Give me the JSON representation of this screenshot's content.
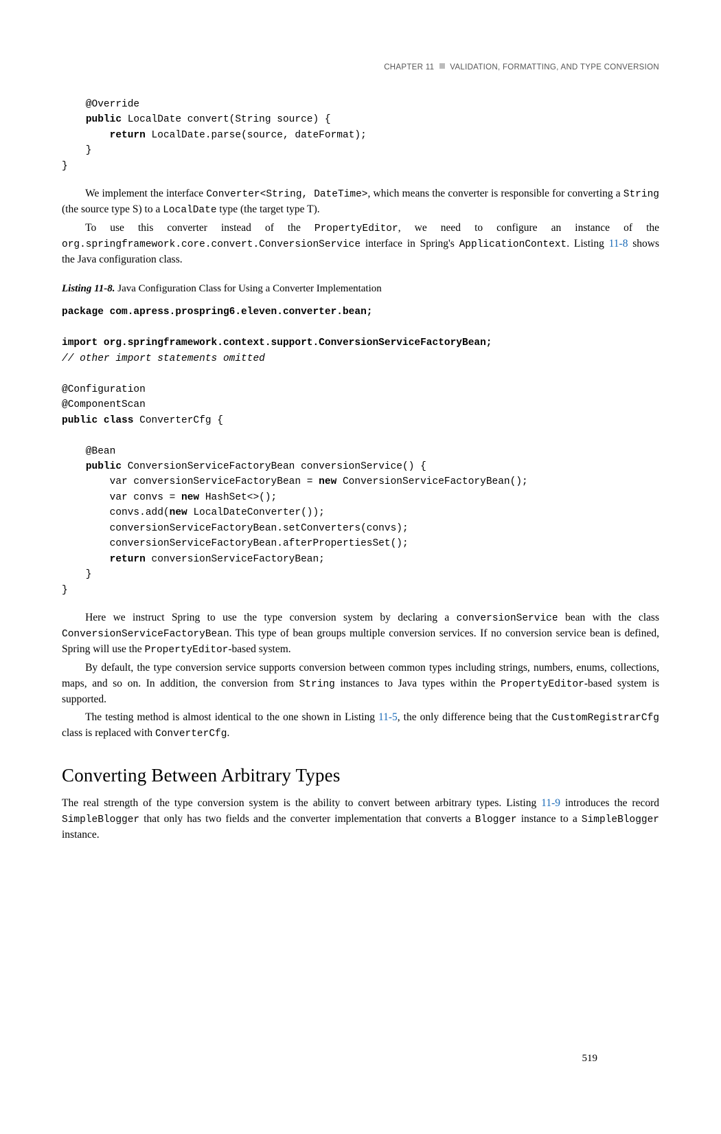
{
  "header": {
    "chapter": "CHAPTER 11",
    "title": "VALIDATION, FORMATTING, AND TYPE CONVERSION"
  },
  "code1": {
    "l1": "    @Override",
    "l2a": "    ",
    "l2_kw1": "public",
    "l2b": " LocalDate convert(String source) {",
    "l3a": "        ",
    "l3_kw1": "return",
    "l3b": " LocalDate.parse(source, dateFormat);",
    "l4": "    }",
    "l5": "}"
  },
  "para1": {
    "t1": "We implement the interface ",
    "m1": "Converter<String, DateTime>",
    "t2": ", which means the converter is responsible for converting a ",
    "m2": "String",
    "t3": " (the source type S) to a ",
    "m3": "LocalDate",
    "t4": " type (the target type T)."
  },
  "para2": {
    "t1": "To use this converter instead of the ",
    "m1": "PropertyEditor",
    "t2": ", we need to configure an instance of the ",
    "m2": "org.springframework.core.convert.ConversionService",
    "t3": " interface in Spring's ",
    "m3": "ApplicationContext",
    "t4": ". Listing ",
    "x1": "11-8",
    "t5": " shows the Java configuration class."
  },
  "listing8": {
    "label": "Listing 11-8.",
    "caption": "  Java Configuration Class for Using a Converter Implementation"
  },
  "code2": {
    "l1_kw": "package",
    "l1": " com.apress.prospring6.eleven.converter.bean;",
    "l3_kw": "import",
    "l3": " org.springframework.context.support.ConversionServiceFactoryBean;",
    "l4": "// other import statements omitted",
    "l6": "@Configuration",
    "l7": "@ComponentScan",
    "l8_kw": "public class",
    "l8": " ConverterCfg {",
    "l10": "    @Bean",
    "l11a": "    ",
    "l11_kw": "public",
    "l11b": " ConversionServiceFactoryBean conversionService() {",
    "l12a": "        var conversionServiceFactoryBean = ",
    "l12_kw": "new",
    "l12b": " ConversionServiceFactoryBean();",
    "l13a": "        var convs = ",
    "l13_kw": "new",
    "l13b": " HashSet<>();",
    "l14a": "        convs.add(",
    "l14_kw": "new",
    "l14b": " LocalDateConverter());",
    "l15": "        conversionServiceFactoryBean.setConverters(convs);",
    "l16": "        conversionServiceFactoryBean.afterPropertiesSet();",
    "l17a": "        ",
    "l17_kw": "return",
    "l17b": " conversionServiceFactoryBean;",
    "l18": "    }",
    "l19": "}"
  },
  "para3": {
    "t1": "Here we instruct Spring to use the type conversion system by declaring a ",
    "m1": "conversionService",
    "t2": " bean with the class ",
    "m2": "ConversionServiceFactoryBean",
    "t3": ". This type of bean groups multiple conversion services. If no conversion service bean is defined, Spring will use the ",
    "m3": "PropertyEditor",
    "t4": "-based system."
  },
  "para4": {
    "t1": "By default, the type conversion service supports conversion between common types including strings, numbers, enums, collections, maps, and so on. In addition, the conversion from ",
    "m1": "String",
    "t2": " instances to Java types within the ",
    "m2": "PropertyEditor",
    "t3": "-based system is supported."
  },
  "para5": {
    "t1": "The testing method is almost identical to the one shown in Listing ",
    "x1": "11-5",
    "t2": ", the only difference being that the ",
    "m1": "CustomRegistrarCfg",
    "t3": " class is replaced with ",
    "m2": "ConverterCfg",
    "t4": "."
  },
  "section": {
    "title": "Converting Between Arbitrary Types"
  },
  "para6": {
    "t1": "The real strength of the type conversion system is the ability to convert between arbitrary types. Listing ",
    "x1": "11-9",
    "t2": " introduces the record ",
    "m1": "SimpleBlogger",
    "t3": " that only has two fields and the converter implementation that converts a ",
    "m2": "Blogger",
    "t4": " instance to a ",
    "m3": "SimpleBlogger",
    "t5": " instance."
  },
  "pageNumber": "519"
}
